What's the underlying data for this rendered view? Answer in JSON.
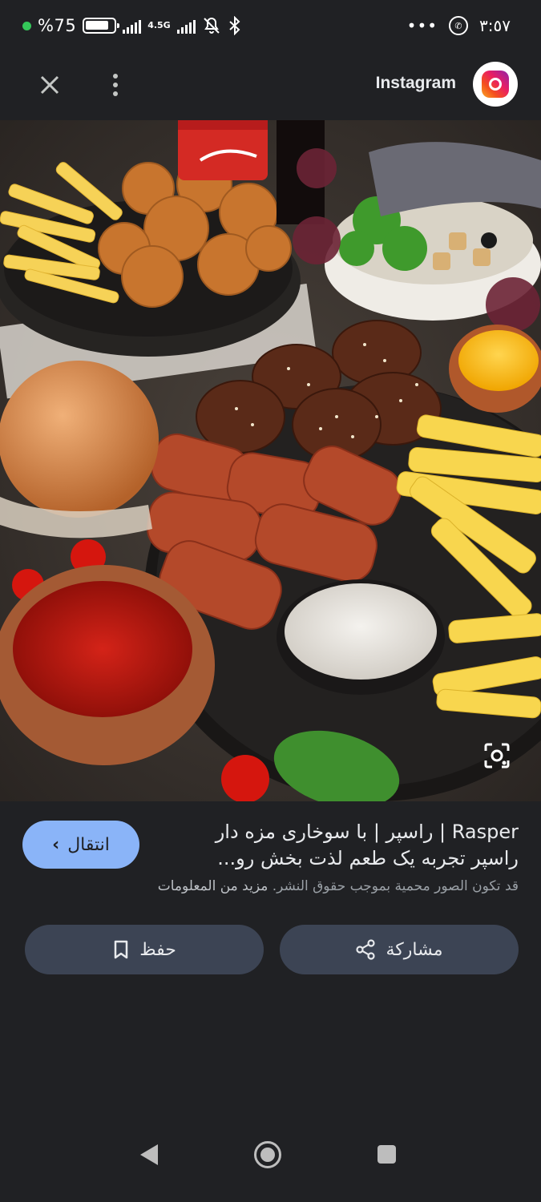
{
  "status_bar": {
    "battery_percent": "%75",
    "network": "4.5G",
    "time": "٣:٥٧",
    "more_indicator": "•••"
  },
  "header": {
    "source_name": "Instagram",
    "close_icon": "close-icon",
    "more_icon": "more-vertical-icon"
  },
  "image": {
    "description_icon": "lens-search-icon"
  },
  "result": {
    "title": "Rasper | راسپر | با سوخاری مزه دار راسپر تجربه یک طعم لذت بخش رو...",
    "copyright_notice": "قد تكون الصور محمية بموجب حقوق النشر.",
    "more_info_link": "مزيد من المعلومات",
    "visit_button": "انتقال"
  },
  "actions": {
    "share_label": "مشاركة",
    "save_label": "حفظ"
  },
  "colors": {
    "background": "#202124",
    "visit_button_bg": "#8ab4f8",
    "action_button_bg": "#3c4454"
  }
}
